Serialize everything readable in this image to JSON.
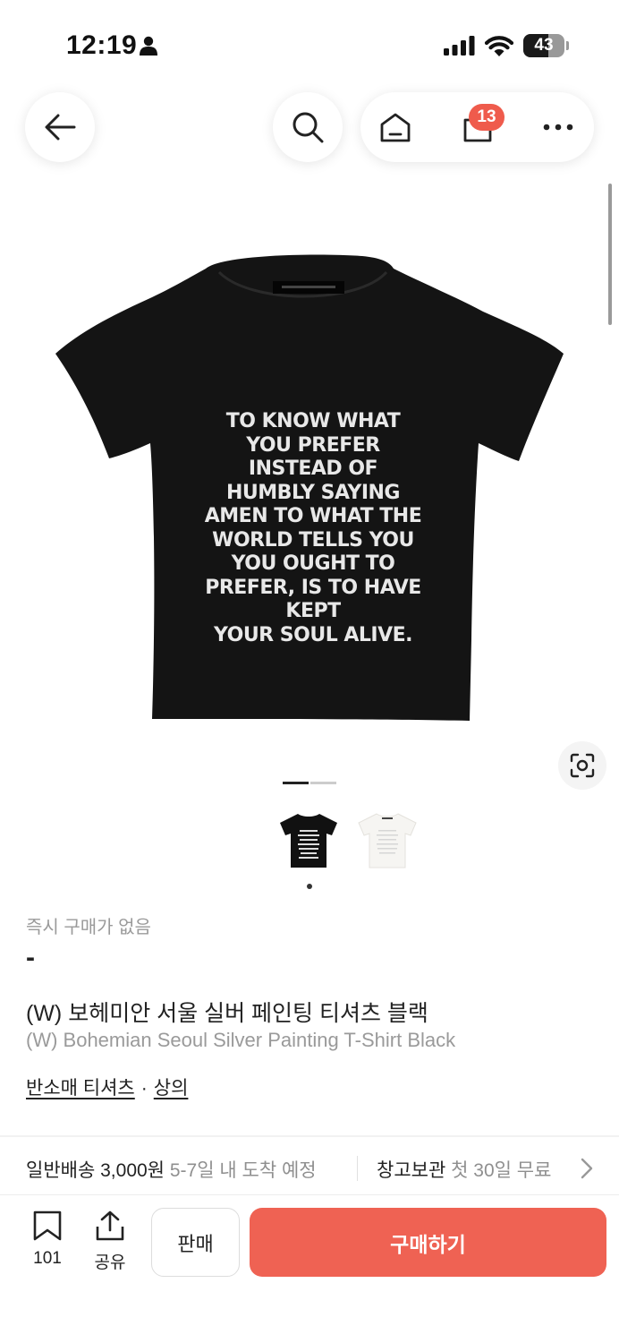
{
  "status_bar": {
    "time": "12:19",
    "battery": "43",
    "icons": [
      "person-icon",
      "cellular-signal-icon",
      "wifi-icon",
      "battery-icon"
    ]
  },
  "nav": {
    "icons": [
      "back-arrow-icon",
      "search-icon",
      "home-icon",
      "shopping-bag-icon",
      "more-icon"
    ],
    "cart_badge": "13"
  },
  "product": {
    "shirt_print": [
      "TO KNOW WHAT",
      "YOU PREFER",
      "INSTEAD OF",
      "HUMBLY SAYING",
      "AMEN TO WHAT THE",
      "WORLD TELLS YOU",
      "YOU OUGHT TO",
      "PREFER, IS TO HAVE",
      "KEPT",
      "YOUR SOUL ALIVE."
    ],
    "instant_label": "즉시 구매가 없음",
    "price": "-",
    "title_ko": "(W) 보헤미안 서울 실버 페인팅 티셔츠 블랙",
    "title_en": "(W) Bohemian Seoul Silver Painting T-Shirt Black",
    "categories": [
      "반소매 티셔츠",
      "상의"
    ],
    "category_separator": "·",
    "thumbnail_colors": [
      "black",
      "white"
    ]
  },
  "shipping": {
    "label": "일반배송",
    "price": "3,000원",
    "eta": "5-7일 내 도착 예정",
    "warehouse_label": "창고보관",
    "warehouse_note": "첫 30일 무료"
  },
  "bottom_bar": {
    "bookmark_count": "101",
    "share_label": "공유",
    "sell_label": "판매",
    "buy_label": "구매하기"
  },
  "colors": {
    "accent": "#ef6253",
    "badge": "#ef5b4c",
    "muted_text": "#9a9a9a"
  }
}
